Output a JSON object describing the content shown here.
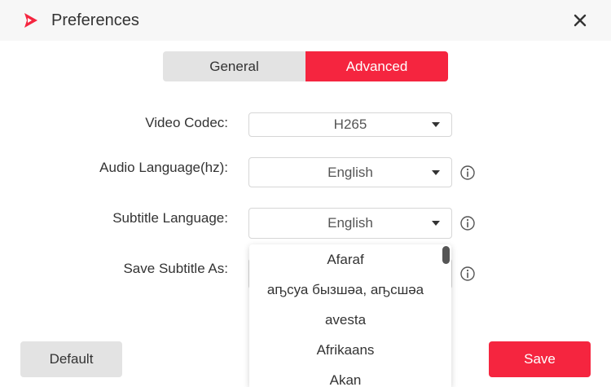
{
  "window": {
    "title": "Preferences",
    "accent_color": "#f5253f",
    "icons": {
      "logo": "play-logo-icon",
      "close": "close-icon",
      "info": "info-icon",
      "dropdown": "caret-down-icon"
    }
  },
  "tabs": [
    {
      "label": "General",
      "active": false
    },
    {
      "label": "Advanced",
      "active": true
    }
  ],
  "settings": {
    "video_codec": {
      "label": "Video Codec:",
      "value": "H265"
    },
    "audio_language": {
      "label": "Audio Language(hz):",
      "value": "English"
    },
    "subtitle_language": {
      "label": "Subtitle Language:",
      "value": "English"
    },
    "save_subtitle_as": {
      "label": "Save Subtitle As:"
    }
  },
  "dropdown": {
    "options": [
      "Afaraf",
      "аҧсуа бызшәа, аҧсшәа",
      "avesta",
      "Afrikaans",
      "Akan"
    ]
  },
  "footer": {
    "default_label": "Default",
    "save_label": "Save"
  }
}
